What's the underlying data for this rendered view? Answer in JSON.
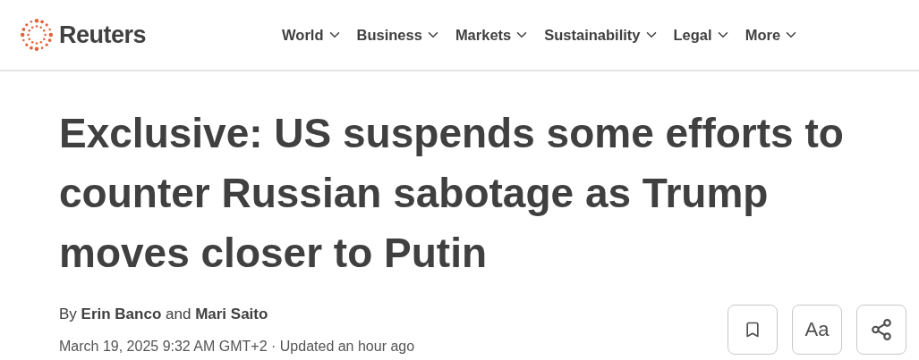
{
  "header": {
    "brand": "Reuters",
    "nav": [
      {
        "label": "World"
      },
      {
        "label": "Business"
      },
      {
        "label": "Markets"
      },
      {
        "label": "Sustainability"
      },
      {
        "label": "Legal"
      },
      {
        "label": "More"
      }
    ]
  },
  "article": {
    "headline": "Exclusive: US suspends some efforts to counter Russian sabotage as Trump moves closer to Putin",
    "byline": "By **Erin Banco** and **Mari Saito**",
    "timestamp": "March 19, 2025 9:32 AM GMT+2 · Updated an hour ago",
    "text_size_button": "Aa"
  }
}
